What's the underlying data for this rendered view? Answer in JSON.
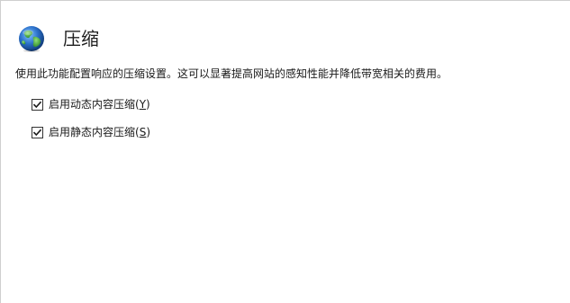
{
  "page": {
    "title": "压缩",
    "description": "使用此功能配置响应的压缩设置。这可以显著提高网站的感知性能并降低带宽相关的费用。",
    "header_icon": "globe-icon"
  },
  "options": {
    "dynamic": {
      "label_prefix": "启用动态内容压缩(",
      "accelerator": "Y",
      "label_suffix": ")",
      "checked": true
    },
    "static": {
      "label_prefix": "启用静态内容压缩(",
      "accelerator": "S",
      "label_suffix": ")",
      "checked": true
    }
  },
  "colors": {
    "globe_ocean": "#2a6fc9",
    "globe_land": "#3fae3a",
    "checkmark": "#1a1a1a"
  }
}
